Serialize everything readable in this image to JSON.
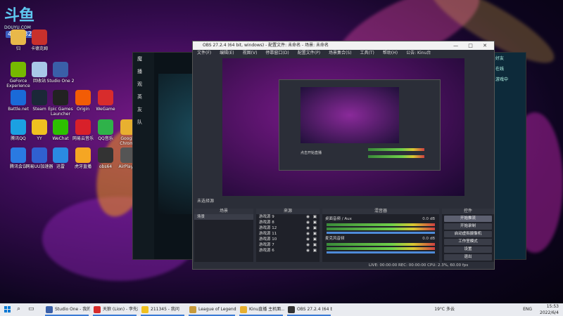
{
  "overlay": {
    "brand_mark": "斗鱼",
    "brand_url": "DOUYU.COM",
    "room_id": "4304323"
  },
  "desktop_icons": [
    {
      "label": "归",
      "color": "#e8b84a"
    },
    {
      "label": "卡德克姆",
      "color": "#c8302c"
    },
    {
      "label": "GeForce Experience",
      "color": "#76b900"
    },
    {
      "label": "回收站",
      "color": "#a8c8e8"
    },
    {
      "label": "Studio One 2",
      "color": "#3a5fa8"
    },
    {
      "label": "Battle.net",
      "color": "#1a6ad8"
    },
    {
      "label": "Steam",
      "color": "#1b2838"
    },
    {
      "label": "Epic Games Launcher",
      "color": "#222"
    },
    {
      "label": "Origin",
      "color": "#f25c05"
    },
    {
      "label": "WeGame",
      "color": "#d82c2c"
    },
    {
      "label": "腾讯QQ",
      "color": "#1ba0e2"
    },
    {
      "label": "YY",
      "color": "#f0c020"
    },
    {
      "label": "WeChat",
      "color": "#2dc100"
    },
    {
      "label": "网易云音乐",
      "color": "#d8202a"
    },
    {
      "label": "QQ音乐",
      "color": "#2fb24a"
    },
    {
      "label": "Google Chrome",
      "color": "#e8b030"
    },
    {
      "label": "腾讯会议",
      "color": "#2a7ae2"
    },
    {
      "label": "网易UU加速器",
      "color": "#3060d0"
    },
    {
      "label": "迅雷",
      "color": "#2a8ae2"
    },
    {
      "label": "虎牙直播",
      "color": "#f5a623"
    },
    {
      "label": "obs64",
      "color": "#333"
    },
    {
      "label": "AirPlayer",
      "color": "#555"
    }
  ],
  "obs": {
    "title": "OBS 27.2.4 (64 bit, windows) - 配置文件: 未命名 - 场景: 未命名",
    "menu": [
      "文件(F)",
      "编辑(E)",
      "视图(V)",
      "停靠窗口(D)",
      "配置文件(P)",
      "场景集合(S)",
      "工具(T)",
      "帮助(H)",
      "公告: Kinu台"
    ],
    "status_bar": "未选择源",
    "docks": {
      "scenes_title": "场景",
      "sources_title": "来源",
      "mixer_title": "混音器",
      "controls_title": "控件"
    },
    "scenes": [
      "场景"
    ],
    "sources": [
      "游戏源 9",
      "游戏源 8",
      "游戏源 12",
      "游戏源 11",
      "游戏源 10",
      "游戏源 7",
      "游戏源 6"
    ],
    "mixer": [
      {
        "name": "桌面音频 / Aux",
        "db": "0.0 dB"
      },
      {
        "name": "麦克风音频",
        "db": "0.0 dB"
      }
    ],
    "controls": [
      "开始推流",
      "开始录制",
      "启动虚拟摄像机",
      "工作室模式",
      "设置",
      "退出"
    ],
    "bottom_status": "LIVE: 00:00:00   REC: 00:00:00   CPU: 2.3%, 60.00 fps",
    "preview_subtitle": "点击开始直播"
  },
  "lol_client": {
    "side_labels": [
      "魔",
      "播",
      "观",
      "英",
      "友",
      "队"
    ],
    "right_panel": [
      "好友",
      "在线",
      "游戏中"
    ]
  },
  "taskbar": {
    "items": [
      {
        "label": "Studio One - 我的...",
        "color": "#3a5fa8"
      },
      {
        "label": "天狼 (Lion) - 李先凯",
        "color": "#d82c2c"
      },
      {
        "label": "211345 - 我问",
        "color": "#f0c020"
      },
      {
        "label": "League of Legends",
        "color": "#c89b3c"
      },
      {
        "label": "Kinu直播 主机面...",
        "color": "#e8b030"
      },
      {
        "label": "OBS 27.2.4 (64 bit...",
        "color": "#333"
      }
    ],
    "weather": "19°C 多云",
    "lang": "ENG",
    "time": "15:53",
    "date": "2022/6/4"
  }
}
